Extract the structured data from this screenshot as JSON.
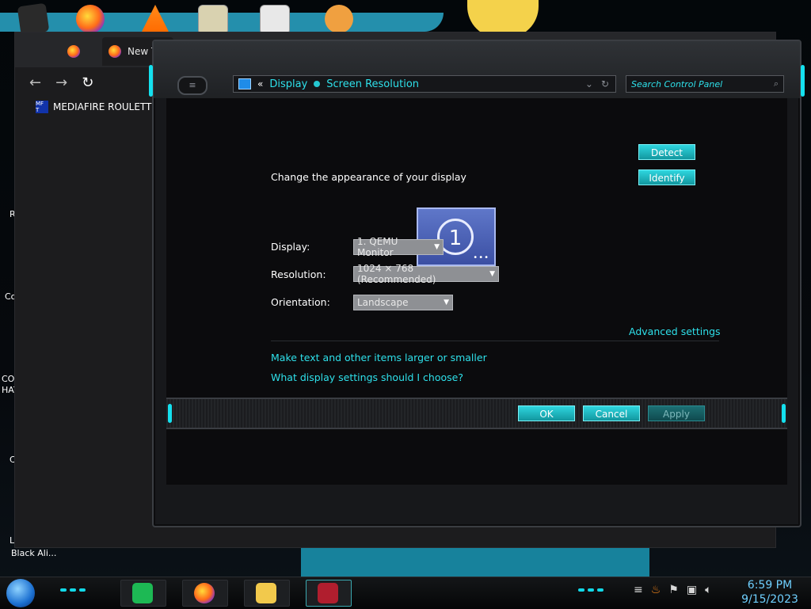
{
  "browser": {
    "tabs": [
      {
        "label": ""
      },
      {
        "label": "New Tab"
      }
    ],
    "bookmark": {
      "icon_text": "MF T",
      "label": "MEDIAFIRE ROULETTE!"
    }
  },
  "desktop": {
    "left_labels": [
      "R",
      "Co",
      "COI",
      "HAT",
      "C",
      "L",
      "Black Ali..."
    ]
  },
  "control_panel": {
    "breadcrumb": {
      "prefix": "«",
      "items": [
        "Display",
        "Screen Resolution"
      ]
    },
    "search": {
      "placeholder": "Search Control Panel"
    },
    "heading": "Change the appearance of your display",
    "monitor_number": "1",
    "buttons": {
      "detect": "Detect",
      "identify": "Identify"
    },
    "fields": {
      "display_label": "Display:",
      "display_value": "1. QEMU Monitor",
      "resolution_label": "Resolution:",
      "resolution_value": "1024 × 768 (Recommended)",
      "orientation_label": "Orientation:",
      "orientation_value": "Landscape"
    },
    "links": {
      "advanced": "Advanced settings",
      "text_size": "Make text and other items larger or smaller",
      "what_settings": "What display settings should I choose?"
    },
    "actions": {
      "ok": "OK",
      "cancel": "Cancel",
      "apply": "Apply"
    }
  },
  "taskbar": {
    "clock_time": "6:59 PM",
    "clock_date": "9/15/2023",
    "tray_icons": [
      "network-icon",
      "flag-icon",
      "volume-icon"
    ]
  },
  "colors": {
    "accent_cyan": "#2ee0ea",
    "button_teal": "#12979f"
  }
}
